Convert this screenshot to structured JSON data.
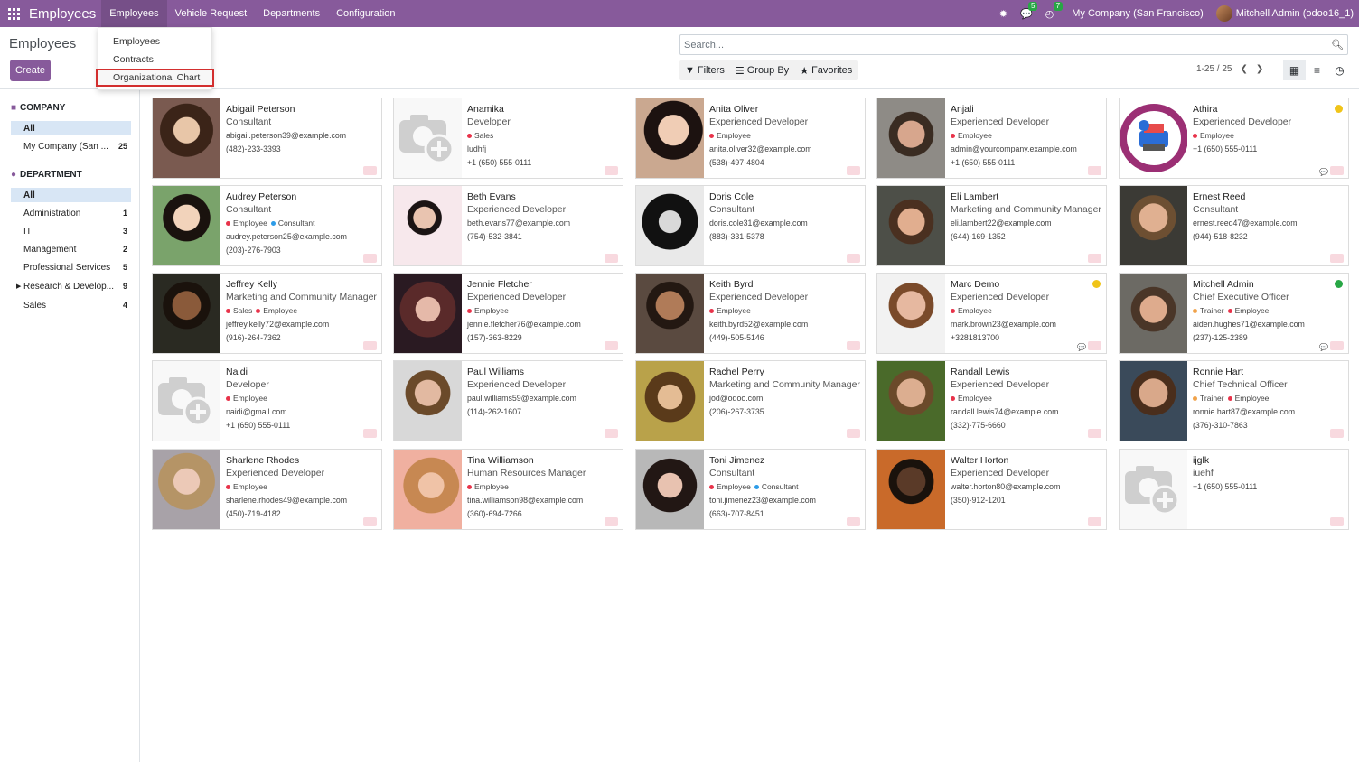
{
  "topbar": {
    "app": "Employees",
    "menus": [
      "Employees",
      "Vehicle Request",
      "Departments",
      "Configuration"
    ],
    "chat_count": "5",
    "activity_count": "7",
    "company": "My Company (San Francisco)",
    "user": "Mitchell Admin (odoo16_1)"
  },
  "dropdown": {
    "items": [
      "Employees",
      "Contracts",
      "Organizational Chart"
    ]
  },
  "control": {
    "title": "Employees",
    "create": "Create",
    "search_placeholder": "Search...",
    "filters": "Filters",
    "group_by": "Group By",
    "favorites": "Favorites",
    "pager": "1-25 / 25"
  },
  "sidebar": {
    "company_title": "COMPANY",
    "company_items": [
      {
        "label": "All",
        "count": ""
      },
      {
        "label": "My Company (San ...",
        "count": "25"
      }
    ],
    "dept_title": "DEPARTMENT",
    "dept_items": [
      {
        "label": "All",
        "count": ""
      },
      {
        "label": "Administration",
        "count": "1"
      },
      {
        "label": "IT",
        "count": "3"
      },
      {
        "label": "Management",
        "count": "2"
      },
      {
        "label": "Professional Services",
        "count": "5"
      },
      {
        "label": "Research & Develop...",
        "count": "9"
      },
      {
        "label": "Sales",
        "count": "4"
      }
    ]
  },
  "colors": {
    "primary": "#875a9b",
    "tag_red": "#e8334a",
    "tag_blue": "#2d9ce8",
    "tag_orange": "#f0a24a",
    "status_yellow": "#f0c419",
    "status_green": "#28a745"
  },
  "employees": [
    {
      "name": "Abigail Peterson",
      "job": "Consultant",
      "tags": [],
      "email": "abigail.peterson39@example.com",
      "phone": "(482)-233-3393",
      "photo": "woman1"
    },
    {
      "name": "Anamika",
      "job": "Developer",
      "tags": [
        {
          "t": "Sales",
          "c": "red"
        }
      ],
      "email": "ludhfj",
      "phone": "+1 (650) 555-0111",
      "photo": "blank"
    },
    {
      "name": "Anita Oliver",
      "job": "Experienced Developer",
      "tags": [
        {
          "t": "Employee",
          "c": "red"
        }
      ],
      "email": "anita.oliver32@example.com",
      "phone": "(538)-497-4804",
      "photo": "woman2"
    },
    {
      "name": "Anjali",
      "job": "Experienced Developer",
      "tags": [
        {
          "t": "Employee",
          "c": "red"
        }
      ],
      "email": "admin@yourcompany.example.com",
      "phone": "+1 (650) 555-0111",
      "photo": "man1"
    },
    {
      "name": "Athira",
      "job": "Experienced Developer",
      "tags": [
        {
          "t": "Employee",
          "c": "red"
        }
      ],
      "email": "+1 (650) 555-0111",
      "phone": "",
      "photo": "logo",
      "status": "yellow",
      "chat": true
    },
    {
      "name": "Audrey Peterson",
      "job": "Consultant",
      "tags": [
        {
          "t": "Employee",
          "c": "red"
        },
        {
          "t": "Consultant",
          "c": "blue"
        }
      ],
      "email": "audrey.peterson25@example.com",
      "phone": "(203)-276-7903",
      "photo": "woman3"
    },
    {
      "name": "Beth Evans",
      "job": "Experienced Developer",
      "tags": [],
      "email": "beth.evans77@example.com",
      "phone": "(754)-532-3841",
      "photo": "woman4"
    },
    {
      "name": "Doris Cole",
      "job": "Consultant",
      "tags": [],
      "email": "doris.cole31@example.com",
      "phone": "(883)-331-5378",
      "photo": "woman5"
    },
    {
      "name": "Eli Lambert",
      "job": "Marketing and Community Manager",
      "tags": [],
      "email": "eli.lambert22@example.com",
      "phone": "(644)-169-1352",
      "photo": "man2"
    },
    {
      "name": "Ernest Reed",
      "job": "Consultant",
      "tags": [],
      "email": "ernest.reed47@example.com",
      "phone": "(944)-518-8232",
      "photo": "man3"
    },
    {
      "name": "Jeffrey Kelly",
      "job": "Marketing and Community Manager",
      "tags": [
        {
          "t": "Sales",
          "c": "red"
        },
        {
          "t": "Employee",
          "c": "red"
        }
      ],
      "email": "jeffrey.kelly72@example.com",
      "phone": "(916)-264-7362",
      "photo": "man4"
    },
    {
      "name": "Jennie Fletcher",
      "job": "Experienced Developer",
      "tags": [
        {
          "t": "Employee",
          "c": "red"
        }
      ],
      "email": "jennie.fletcher76@example.com",
      "phone": "(157)-363-8229",
      "photo": "woman6"
    },
    {
      "name": "Keith Byrd",
      "job": "Experienced Developer",
      "tags": [
        {
          "t": "Employee",
          "c": "red"
        }
      ],
      "email": "keith.byrd52@example.com",
      "phone": "(449)-505-5146",
      "photo": "man5"
    },
    {
      "name": "Marc Demo",
      "job": "Experienced Developer",
      "tags": [
        {
          "t": "Employee",
          "c": "red"
        }
      ],
      "email": "mark.brown23@example.com",
      "phone": "+3281813700",
      "photo": "man6",
      "status": "yellow",
      "chat": true
    },
    {
      "name": "Mitchell Admin",
      "job": "Chief Executive Officer",
      "tags": [
        {
          "t": "Trainer",
          "c": "orange"
        },
        {
          "t": "Employee",
          "c": "red"
        }
      ],
      "email": "aiden.hughes71@example.com",
      "phone": "(237)-125-2389",
      "photo": "man7",
      "status": "green",
      "chat": true
    },
    {
      "name": "Naidi",
      "job": "Developer",
      "tags": [
        {
          "t": "Employee",
          "c": "red"
        }
      ],
      "email": "naidi@gmail.com",
      "phone": "+1 (650) 555-0111",
      "photo": "blank"
    },
    {
      "name": "Paul Williams",
      "job": "Experienced Developer",
      "tags": [],
      "email": "paul.williams59@example.com",
      "phone": "(114)-262-1607",
      "photo": "man8"
    },
    {
      "name": "Rachel Perry",
      "job": "Marketing and Community Manager",
      "tags": [],
      "email": "jod@odoo.com",
      "phone": "(206)-267-3735",
      "photo": "woman7"
    },
    {
      "name": "Randall Lewis",
      "job": "Experienced Developer",
      "tags": [
        {
          "t": "Employee",
          "c": "red"
        }
      ],
      "email": "randall.lewis74@example.com",
      "phone": "(332)-775-6660",
      "photo": "man9"
    },
    {
      "name": "Ronnie Hart",
      "job": "Chief Technical Officer",
      "tags": [
        {
          "t": "Trainer",
          "c": "orange"
        },
        {
          "t": "Employee",
          "c": "red"
        }
      ],
      "email": "ronnie.hart87@example.com",
      "phone": "(376)-310-7863",
      "photo": "man10"
    },
    {
      "name": "Sharlene Rhodes",
      "job": "Experienced Developer",
      "tags": [
        {
          "t": "Employee",
          "c": "red"
        }
      ],
      "email": "sharlene.rhodes49@example.com",
      "phone": "(450)-719-4182",
      "photo": "woman8"
    },
    {
      "name": "Tina Williamson",
      "job": "Human Resources Manager",
      "tags": [
        {
          "t": "Employee",
          "c": "red"
        }
      ],
      "email": "tina.williamson98@example.com",
      "phone": "(360)-694-7266",
      "photo": "woman9"
    },
    {
      "name": "Toni Jimenez",
      "job": "Consultant",
      "tags": [
        {
          "t": "Employee",
          "c": "red"
        },
        {
          "t": "Consultant",
          "c": "blue"
        }
      ],
      "email": "toni.jimenez23@example.com",
      "phone": "(663)-707-8451",
      "photo": "woman10"
    },
    {
      "name": "Walter Horton",
      "job": "Experienced Developer",
      "tags": [],
      "email": "walter.horton80@example.com",
      "phone": "(350)-912-1201",
      "photo": "man11"
    },
    {
      "name": "ijglk",
      "job": "iuehf",
      "tags": [],
      "email": "+1 (650) 555-0111",
      "phone": "",
      "photo": "blank"
    }
  ]
}
